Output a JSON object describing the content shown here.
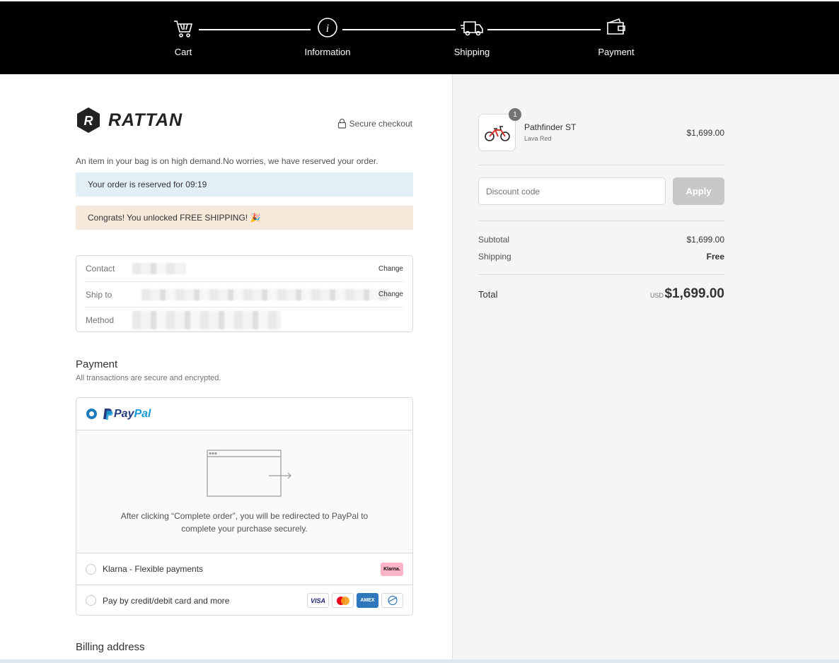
{
  "steps": [
    {
      "label": "Cart",
      "icon": "cart-icon"
    },
    {
      "label": "Information",
      "icon": "info-icon"
    },
    {
      "label": "Shipping",
      "icon": "truck-icon"
    },
    {
      "label": "Payment",
      "icon": "wallet-icon"
    }
  ],
  "brand": {
    "name": "RATTAN"
  },
  "secure_checkout": "Secure checkout",
  "demand_note": "An item in your bag is on high demand.No worries, we have reserved your order.",
  "reservation": "Your order is reserved for 09:19",
  "free_shipping": "Congrats! You unlocked FREE SHIPPING! 🎉",
  "review": {
    "contact_label": "Contact",
    "shipto_label": "Ship to",
    "method_label": "Method",
    "change_label": "Change",
    "change_label_2": "Change"
  },
  "payment": {
    "title": "Payment",
    "subtitle": "All transactions are secure and encrypted.",
    "paypal_pay": "Pay",
    "paypal_pal": "Pal",
    "paypal_note": "After clicking “Complete order”, you will be redirected to PayPal to complete your purchase securely.",
    "klarna_label": "Klarna - Flexible payments",
    "klarna_badge": "Klarna.",
    "card_label": "Pay by credit/debit card and more",
    "card_visa": "VISA",
    "card_amex": "AMEX"
  },
  "billing_title": "Billing address",
  "summary": {
    "product_name": "Pathfinder ST",
    "product_variant": "Lava Red",
    "product_qty": "1",
    "product_price": "$1,699.00",
    "discount_placeholder": "Discount code",
    "apply_label": "Apply",
    "subtotal_label": "Subtotal",
    "subtotal_value": "$1,699.00",
    "shipping_label": "Shipping",
    "shipping_value": "Free",
    "total_label": "Total",
    "currency": "USD",
    "total_value": "$1,699.00"
  },
  "colors": {
    "header_bg": "#000000",
    "reserve_bg": "#e3eff7",
    "shipping_bg": "#f6e8da",
    "paypal_blue": "#179bd7",
    "summary_bg": "#f5f5f5"
  }
}
